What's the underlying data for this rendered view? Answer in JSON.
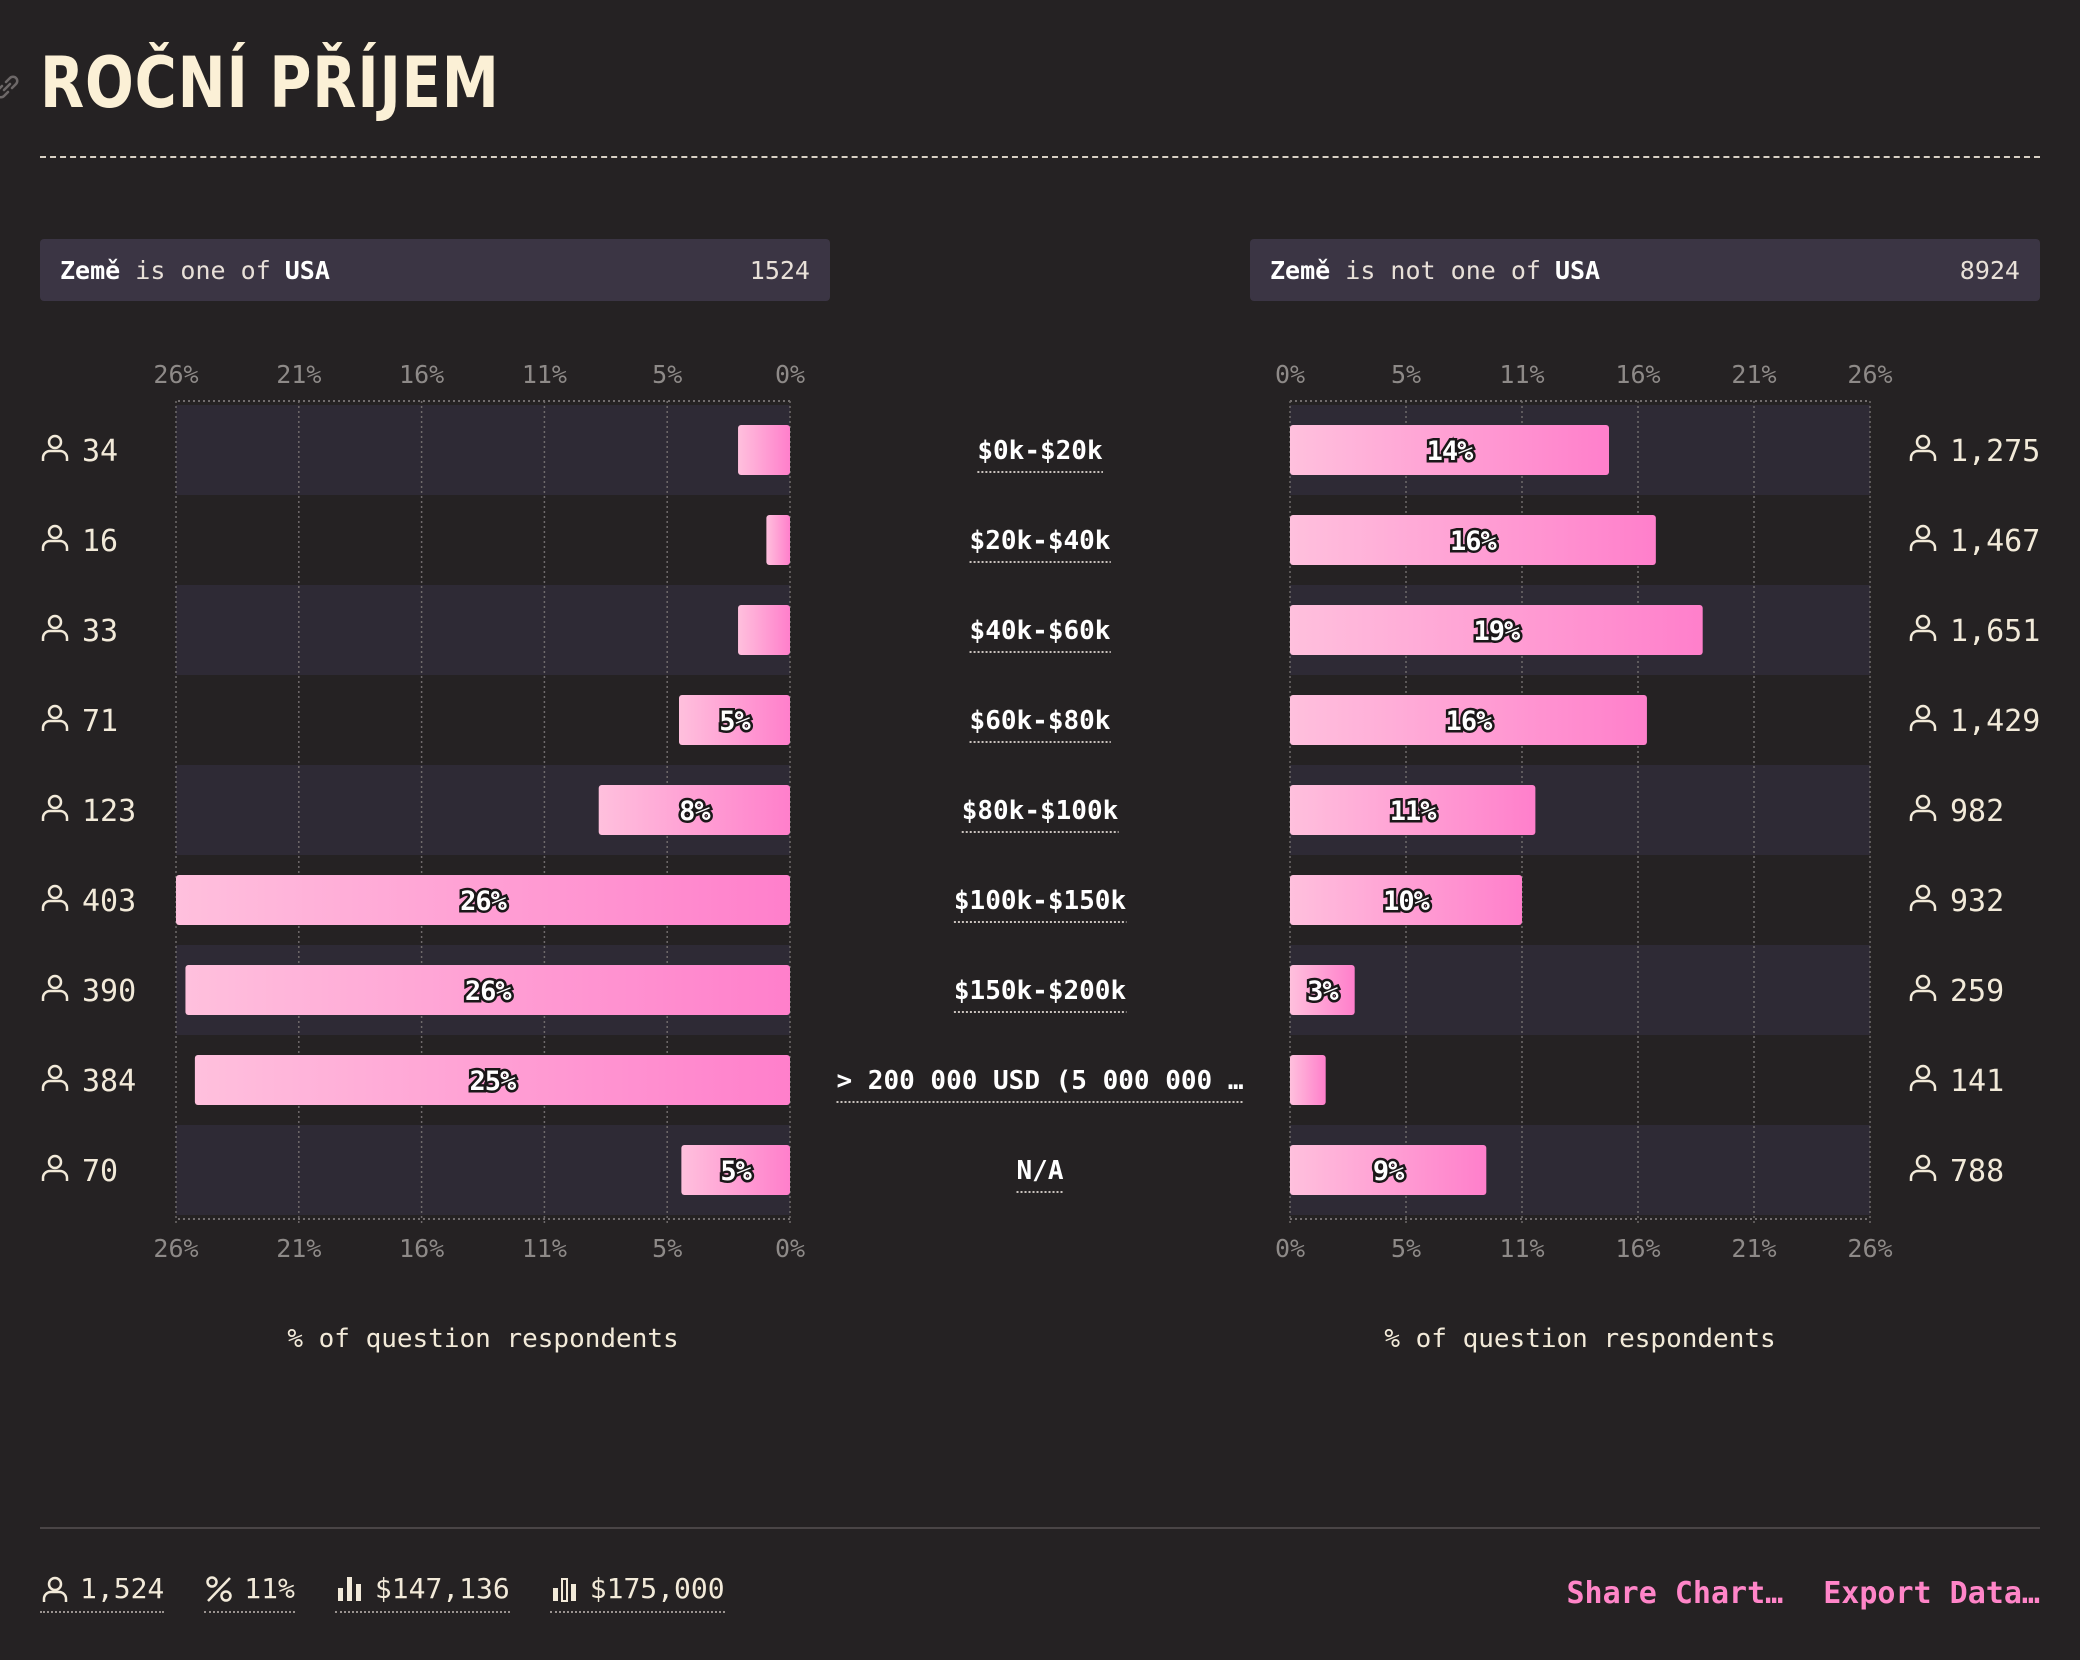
{
  "title": "ROČNÍ PŘÍJEM",
  "filters": {
    "left": {
      "field": "Země",
      "op": "is one of",
      "value": "USA",
      "count": "1524"
    },
    "right": {
      "field": "Země",
      "op": "is not one of",
      "value": "USA",
      "count": "8924"
    }
  },
  "chart_data": {
    "type": "bar",
    "categories": [
      "$0k-$20k",
      "$20k-$40k",
      "$40k-$60k",
      "$60k-$80k",
      "$80k-$100k",
      "$100k-$150k",
      "$150k-$200k",
      "> 200 000 USD (5 000 000 …",
      "N/A"
    ],
    "ticks": [
      "0%",
      "5%",
      "11%",
      "16%",
      "21%",
      "26%"
    ],
    "xlim": [
      0,
      26
    ],
    "xlabel": "% of question respondents",
    "series": [
      {
        "name": "Země is one of USA",
        "values": [
          2.2,
          1.0,
          2.2,
          4.7,
          8.1,
          26.4,
          25.6,
          25.2,
          4.6
        ],
        "labels": [
          "",
          "",
          "",
          "5%",
          "8%",
          "26%",
          "26%",
          "25%",
          "5%"
        ],
        "counts": [
          "34",
          "16",
          "33",
          "71",
          "123",
          "403",
          "390",
          "384",
          "70"
        ]
      },
      {
        "name": "Země is not one of USA",
        "values": [
          14.3,
          16.4,
          18.5,
          16.0,
          11.0,
          10.4,
          2.9,
          1.6,
          8.8
        ],
        "labels": [
          "14%",
          "16%",
          "19%",
          "16%",
          "11%",
          "10%",
          "3%",
          "",
          "9%"
        ],
        "counts": [
          "1,275",
          "1,467",
          "1,651",
          "1,429",
          "982",
          "932",
          "259",
          "141",
          "788"
        ]
      }
    ]
  },
  "stats": {
    "respondents": "1,524",
    "percent": "11%",
    "mean": "$147,136",
    "median": "$175,000"
  },
  "actions": {
    "share": "Share Chart…",
    "export": "Export Data…"
  },
  "colors": {
    "bar_start": "#ffc0dd",
    "bar_end": "#ff7fcb",
    "row_band": "#2e2a35"
  }
}
